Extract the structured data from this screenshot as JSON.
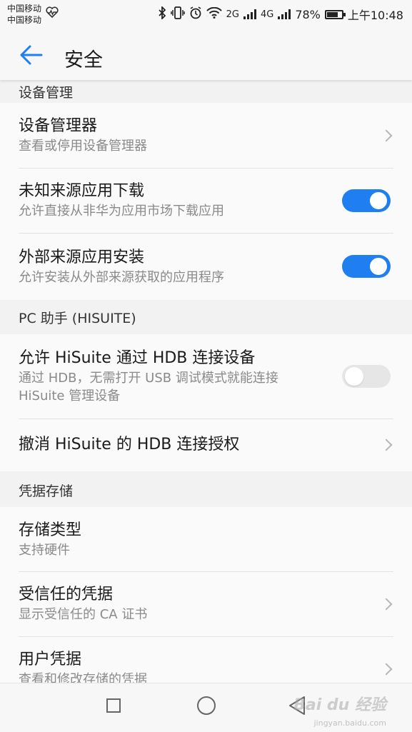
{
  "status_bar": {
    "carrier_1": "中国移动",
    "carrier_2": "中国移动",
    "network_1": "2G",
    "network_2": "4G",
    "battery": "78%",
    "battery_level": 0.78,
    "time": "上午10:48"
  },
  "app_bar": {
    "title": "安全",
    "back_icon": "arrow-left-icon",
    "accent_color": "#1f7ff0"
  },
  "sections": {
    "device_admin": {
      "header": "设备管理",
      "items": [
        {
          "title": "设备管理器",
          "subtitle": "查看或停用设备管理器",
          "control": "chevron"
        },
        {
          "title": "未知来源应用下载",
          "subtitle": "允许直接从非华为应用市场下载应用",
          "control": "toggle",
          "on": true
        },
        {
          "title": "外部来源应用安装",
          "subtitle": "允许安装从外部来源获取的应用程序",
          "control": "toggle",
          "on": true
        }
      ]
    },
    "pc_assistant": {
      "header": "PC 助手 (HISUITE)",
      "items": [
        {
          "title": "允许 HiSuite 通过 HDB 连接设备",
          "subtitle": "通过 HDB，无需打开 USB 调试模式就能连接 HiSuite 管理设备",
          "control": "toggle",
          "on": false
        },
        {
          "title": "撤消 HiSuite 的 HDB 连接授权",
          "control": "chevron"
        }
      ]
    },
    "credential_storage": {
      "header": "凭据存储",
      "items": [
        {
          "title": "存储类型",
          "subtitle": "支持硬件"
        },
        {
          "title": "受信任的凭据",
          "subtitle": "显示受信任的 CA 证书",
          "control": "chevron"
        },
        {
          "title": "用户凭据",
          "subtitle": "查看和修改存储的凭据",
          "control": "chevron"
        }
      ]
    }
  },
  "nav_bar": {
    "icons": [
      "recent-apps-icon",
      "home-icon",
      "back-triangle-icon"
    ]
  },
  "watermark": {
    "text": "Bai du 经验",
    "url": "jingyan.baidu.com"
  }
}
